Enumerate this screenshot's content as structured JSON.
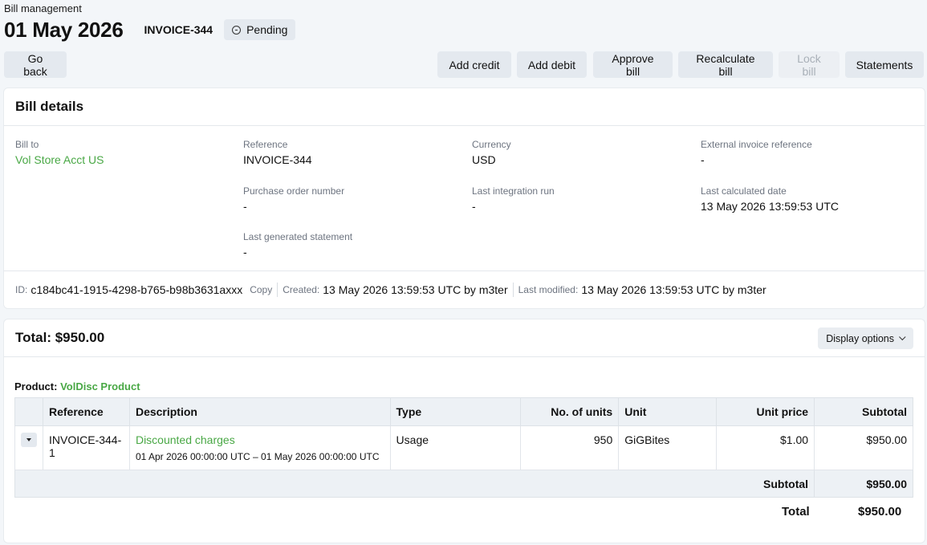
{
  "header": {
    "breadcrumb": "Bill management",
    "title": "01 May 2026",
    "invoice_id": "INVOICE-344",
    "status": "Pending"
  },
  "toolbar": {
    "go_back": "Go back",
    "add_credit": "Add credit",
    "add_debit": "Add debit",
    "approve_bill": "Approve bill",
    "recalculate_bill": "Recalculate bill",
    "lock_bill": "Lock bill",
    "statements": "Statements"
  },
  "details": {
    "title": "Bill details",
    "bill_to_label": "Bill to",
    "bill_to_value": "Vol Store Acct US",
    "reference_label": "Reference",
    "reference_value": "INVOICE-344",
    "currency_label": "Currency",
    "currency_value": "USD",
    "external_ref_label": "External invoice reference",
    "external_ref_value": "-",
    "po_label": "Purchase order number",
    "po_value": "-",
    "last_integration_label": "Last integration run",
    "last_integration_value": "-",
    "last_calculated_label": "Last calculated date",
    "last_calculated_value": "13 May 2026 13:59:53 UTC",
    "last_statement_label": "Last generated statement",
    "last_statement_value": "-",
    "meta": {
      "id_label": "ID:",
      "id_value": "c184bc41-1915-4298-b765-b98b3631axxx",
      "copy": "Copy",
      "created_label": "Created:",
      "created_value": "13 May 2026 13:59:53 UTC by m3ter",
      "modified_label": "Last modified:",
      "modified_value": "13 May 2026 13:59:53 UTC by m3ter"
    }
  },
  "totals": {
    "title": "Total: $950.00",
    "display_options": "Display options",
    "product_label": "Product:",
    "product_name": "VolDisc Product",
    "columns": [
      "Reference",
      "Description",
      "Type",
      "No. of units",
      "Unit",
      "Unit price",
      "Subtotal"
    ],
    "rows": [
      {
        "reference": "INVOICE-344-1",
        "description": "Discounted charges",
        "period": "01 Apr 2026 00:00:00 UTC – 01 May 2026 00:00:00 UTC",
        "type": "Usage",
        "units": "950",
        "unit": "GiGBites",
        "unit_price": "$1.00",
        "subtotal": "$950.00"
      }
    ],
    "subtotal_label": "Subtotal",
    "subtotal_value": "$950.00",
    "total_label": "Total",
    "total_value": "$950.00"
  },
  "colors": {
    "accent": "#49a845",
    "background": "#f3f6f9",
    "button": "#e4e9ef"
  }
}
